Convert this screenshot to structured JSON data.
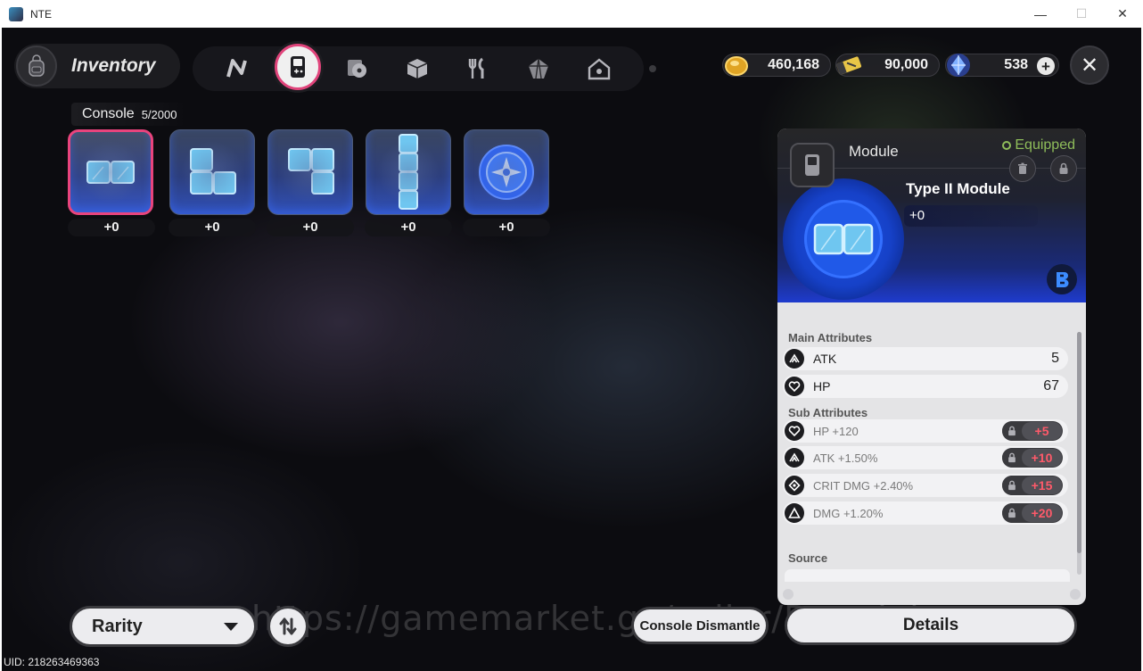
{
  "window": {
    "title": "NTE",
    "controls": {
      "minimize": "—",
      "maximize": "☐",
      "close": "✕"
    }
  },
  "header": {
    "title": "Inventory",
    "bag_icon": "backpack-icon",
    "tabs": [
      {
        "id": "tab-n",
        "icon": "n-logo-icon",
        "active": false
      },
      {
        "id": "tab-console",
        "icon": "handheld-console-icon",
        "active": true
      },
      {
        "id": "tab-disc",
        "icon": "disc-icon",
        "active": false
      },
      {
        "id": "tab-box",
        "icon": "box-icon",
        "active": false
      },
      {
        "id": "tab-food",
        "icon": "fork-knife-icon",
        "active": false
      },
      {
        "id": "tab-crystal",
        "icon": "crystal-icon",
        "active": false
      },
      {
        "id": "tab-home",
        "icon": "home-icon",
        "active": false
      }
    ],
    "currencies": [
      {
        "icon": "gold-coin-icon",
        "value": "460,168"
      },
      {
        "icon": "ticket-icon",
        "value": "90,000"
      },
      {
        "icon": "blue-crystal-icon",
        "value": "538",
        "plus": "+"
      }
    ],
    "close": "✕"
  },
  "console": {
    "label": "Console",
    "count": "5/2000",
    "items": [
      {
        "icon": "module-2x1-icon",
        "level": "+0",
        "selected": true
      },
      {
        "icon": "module-l-shape-icon",
        "level": "+0",
        "selected": false
      },
      {
        "icon": "module-j-shape-icon",
        "level": "+0",
        "selected": false
      },
      {
        "icon": "module-1x4-icon",
        "level": "+0",
        "selected": false
      },
      {
        "icon": "module-compass-core-icon",
        "level": "+0",
        "selected": false
      }
    ]
  },
  "detail": {
    "category": "Module",
    "status": "Equipped",
    "name": "Type II Module",
    "level": "+0",
    "main_title": "Main Attributes",
    "main": [
      {
        "icon": "atk-icon",
        "name": "ATK",
        "value": "5"
      },
      {
        "icon": "hp-icon",
        "name": "HP",
        "value": "67"
      }
    ],
    "sub_title": "Sub Attributes",
    "sub": [
      {
        "icon": "hp-icon",
        "name": "HP +120",
        "bonus": "+5"
      },
      {
        "icon": "atk-icon",
        "name": "ATK +1.50%",
        "bonus": "+10"
      },
      {
        "icon": "crit-dmg-icon",
        "name": "CRIT DMG +2.40%",
        "bonus": "+15"
      },
      {
        "icon": "dmg-icon",
        "name": "DMG +1.20%",
        "bonus": "+20"
      }
    ],
    "source_title": "Source"
  },
  "footer": {
    "rarity_label": "Rarity",
    "dismantle_label": "Console Dismantle",
    "details_label": "Details",
    "uid": "UID: 218263469363",
    "watermark": "https://gamemarket.gg/seller/DangJohn"
  },
  "colors": {
    "accent_pink": "#e9447d",
    "equipped_green": "#8fbd5a",
    "bonus_red": "#ff5a6a",
    "module_blue": "#1e3bcd"
  }
}
